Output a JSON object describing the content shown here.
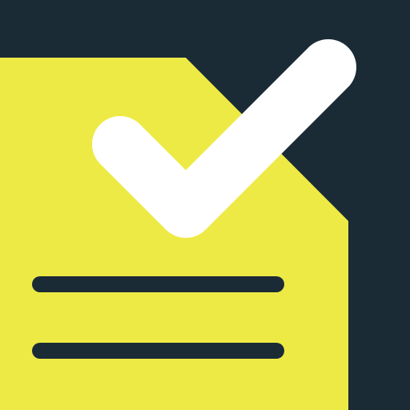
{
  "icon": {
    "name": "checked-document-icon",
    "colors": {
      "background": "#1b2b36",
      "document": "#eeea45",
      "check": "#ffffff",
      "lines": "#1b2b36"
    }
  }
}
